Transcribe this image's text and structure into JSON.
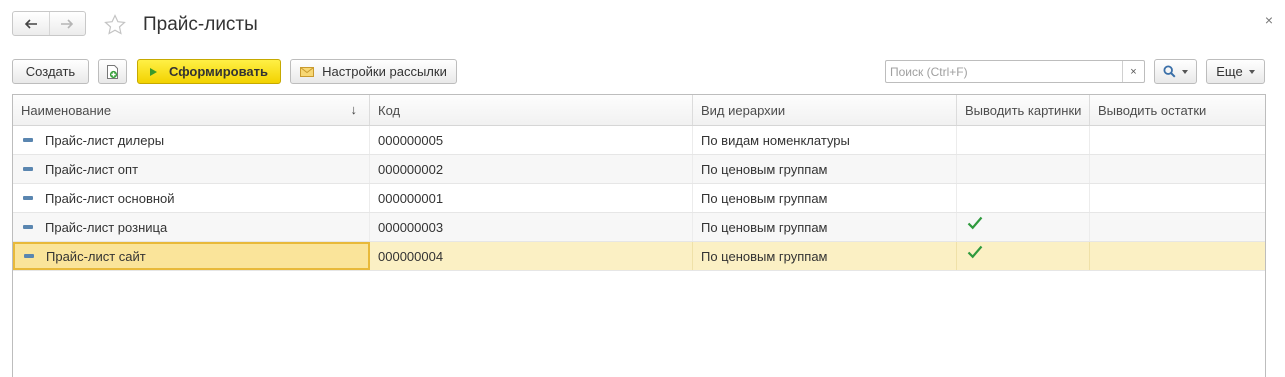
{
  "window": {
    "title": "Прайс-листы",
    "close_glyph": "×"
  },
  "toolbar": {
    "create_label": "Создать",
    "copy_icon": "add-copy-icon",
    "generate_label": "Сформировать",
    "settings_label": "Настройки рассылки",
    "search_placeholder": "Поиск (Ctrl+F)",
    "search_clear_glyph": "×",
    "more_label": "Еще"
  },
  "colors": {
    "generate_button": "#f2d200",
    "selected_row": "#fbf0c4",
    "selected_cell_border": "#e8b93a",
    "checkmark": "#2f9a3e",
    "item_icon": "#5a86b0"
  },
  "table": {
    "columns": [
      "Наименование",
      "Код",
      "Вид иерархии",
      "Выводить картинки",
      "Выводить остатки"
    ],
    "sort_indicator": "↓",
    "rows": [
      {
        "name": "Прайс-лист дилеры",
        "code": "000000005",
        "hierarchy": "По видам номенклатуры",
        "show_images": false,
        "show_stock": false,
        "selected": false
      },
      {
        "name": "Прайс-лист опт",
        "code": "000000002",
        "hierarchy": "По ценовым группам",
        "show_images": false,
        "show_stock": false,
        "selected": false
      },
      {
        "name": "Прайс-лист основной",
        "code": "000000001",
        "hierarchy": "По ценовым группам",
        "show_images": false,
        "show_stock": false,
        "selected": false
      },
      {
        "name": "Прайс-лист розница",
        "code": "000000003",
        "hierarchy": "По ценовым группам",
        "show_images": true,
        "show_stock": false,
        "selected": false
      },
      {
        "name": "Прайс-лист сайт",
        "code": "000000004",
        "hierarchy": "По ценовым группам",
        "show_images": true,
        "show_stock": false,
        "selected": true
      }
    ]
  }
}
